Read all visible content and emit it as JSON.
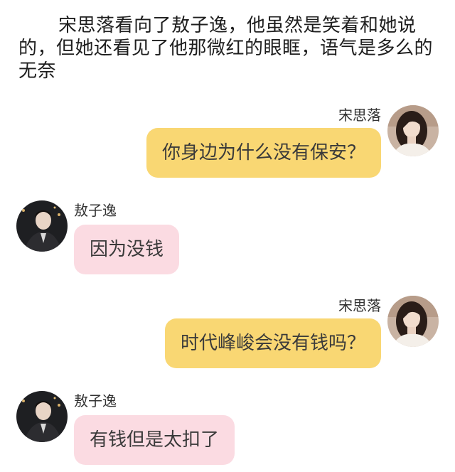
{
  "narration": "宋思落看向了敖子逸，他虽然是笑着和她说的，但她还看见了他那微红的眼眶，语气是多么的无奈",
  "messages": [
    {
      "sender": "宋思落",
      "text": "你身边为什么没有保安？",
      "side": "right",
      "avatar_icon": "girl-avatar-icon",
      "bubble_color": "#f9d773"
    },
    {
      "sender": "敖子逸",
      "text": "因为没钱",
      "side": "left",
      "avatar_icon": "boy-avatar-icon",
      "bubble_color": "#fbdbe2"
    },
    {
      "sender": "宋思落",
      "text": "时代峰峻会没有钱吗？",
      "side": "right",
      "avatar_icon": "girl-avatar-icon",
      "bubble_color": "#f9d773"
    },
    {
      "sender": "敖子逸",
      "text": "有钱但是太扣了",
      "side": "left",
      "avatar_icon": "boy-avatar-icon",
      "bubble_color": "#fbdbe2"
    }
  ]
}
